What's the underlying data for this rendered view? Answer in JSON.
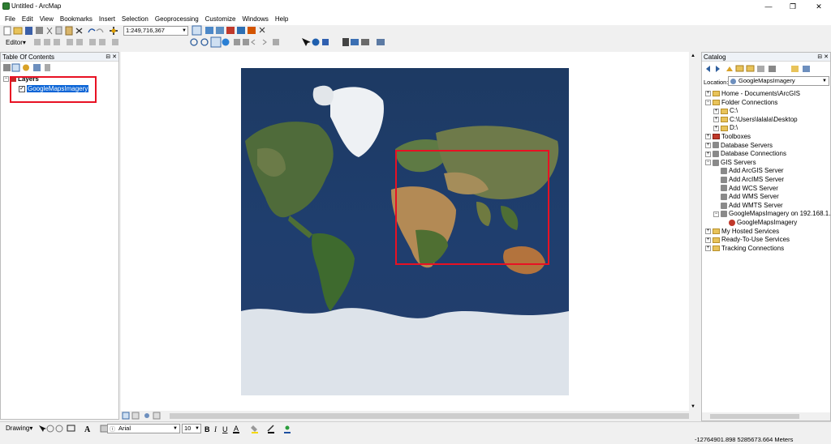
{
  "window": {
    "title": "Untitled - ArcMap",
    "minimize": "—",
    "maximize": "❐",
    "close": "✕"
  },
  "menu": [
    "File",
    "Edit",
    "View",
    "Bookmarks",
    "Insert",
    "Selection",
    "Geoprocessing",
    "Customize",
    "Windows",
    "Help"
  ],
  "toolbar": {
    "scale_value": "1:249,716,367",
    "editor_label": "Editor▾"
  },
  "toc": {
    "title": "Table Of Contents",
    "root": "Layers",
    "layer": "GoogleMapsImagery",
    "layer_checked": true
  },
  "catalog": {
    "title": "Catalog",
    "location_label": "Location:",
    "location_value": "GoogleMapsImagery",
    "tree": [
      {
        "label": "Home - Documents\\ArcGIS",
        "icon": "folder-icon",
        "level": 0,
        "exp": "+"
      },
      {
        "label": "Folder Connections",
        "icon": "folder-icon",
        "level": 0,
        "exp": "−"
      },
      {
        "label": "C:\\",
        "icon": "folder-icon",
        "level": 1,
        "exp": "+"
      },
      {
        "label": "C:\\Users\\lalala\\Desktop",
        "icon": "folder-icon",
        "level": 1,
        "exp": "+"
      },
      {
        "label": "D:\\",
        "icon": "folder-icon",
        "level": 1,
        "exp": "+"
      },
      {
        "label": "Toolboxes",
        "icon": "toolbox-icon",
        "level": 0,
        "exp": "+"
      },
      {
        "label": "Database Servers",
        "icon": "server-icon",
        "level": 0,
        "exp": "+"
      },
      {
        "label": "Database Connections",
        "icon": "server-icon",
        "level": 0,
        "exp": "+"
      },
      {
        "label": "GIS Servers",
        "icon": "server-icon",
        "level": 0,
        "exp": "−"
      },
      {
        "label": "Add ArcGIS Server",
        "icon": "server-icon",
        "level": 1,
        "exp": ""
      },
      {
        "label": "Add ArcIMS Server",
        "icon": "server-icon",
        "level": 1,
        "exp": ""
      },
      {
        "label": "Add WCS Server",
        "icon": "server-icon",
        "level": 1,
        "exp": ""
      },
      {
        "label": "Add WMS Server",
        "icon": "server-icon",
        "level": 1,
        "exp": ""
      },
      {
        "label": "Add WMTS Server",
        "icon": "server-icon",
        "level": 1,
        "exp": ""
      },
      {
        "label": "GoogleMapsImagery on 192.168.1.1",
        "icon": "server-icon",
        "level": 1,
        "exp": "−"
      },
      {
        "label": "GoogleMapsImagery",
        "icon": "globe-icon",
        "level": 2,
        "exp": ""
      },
      {
        "label": "My Hosted Services",
        "icon": "folder-icon",
        "level": 0,
        "exp": "+"
      },
      {
        "label": "Ready-To-Use Services",
        "icon": "folder-icon",
        "level": 0,
        "exp": "+"
      },
      {
        "label": "Tracking Connections",
        "icon": "folder-icon",
        "level": 0,
        "exp": "+"
      }
    ]
  },
  "drawing": {
    "label": "Drawing▾",
    "font_name": "Arial",
    "font_size": "10"
  },
  "status": {
    "coordinates": "-12764901.898  5285673.664 Meters"
  },
  "colors": {
    "highlight": "#e81123",
    "selection": "#0a64d6"
  }
}
